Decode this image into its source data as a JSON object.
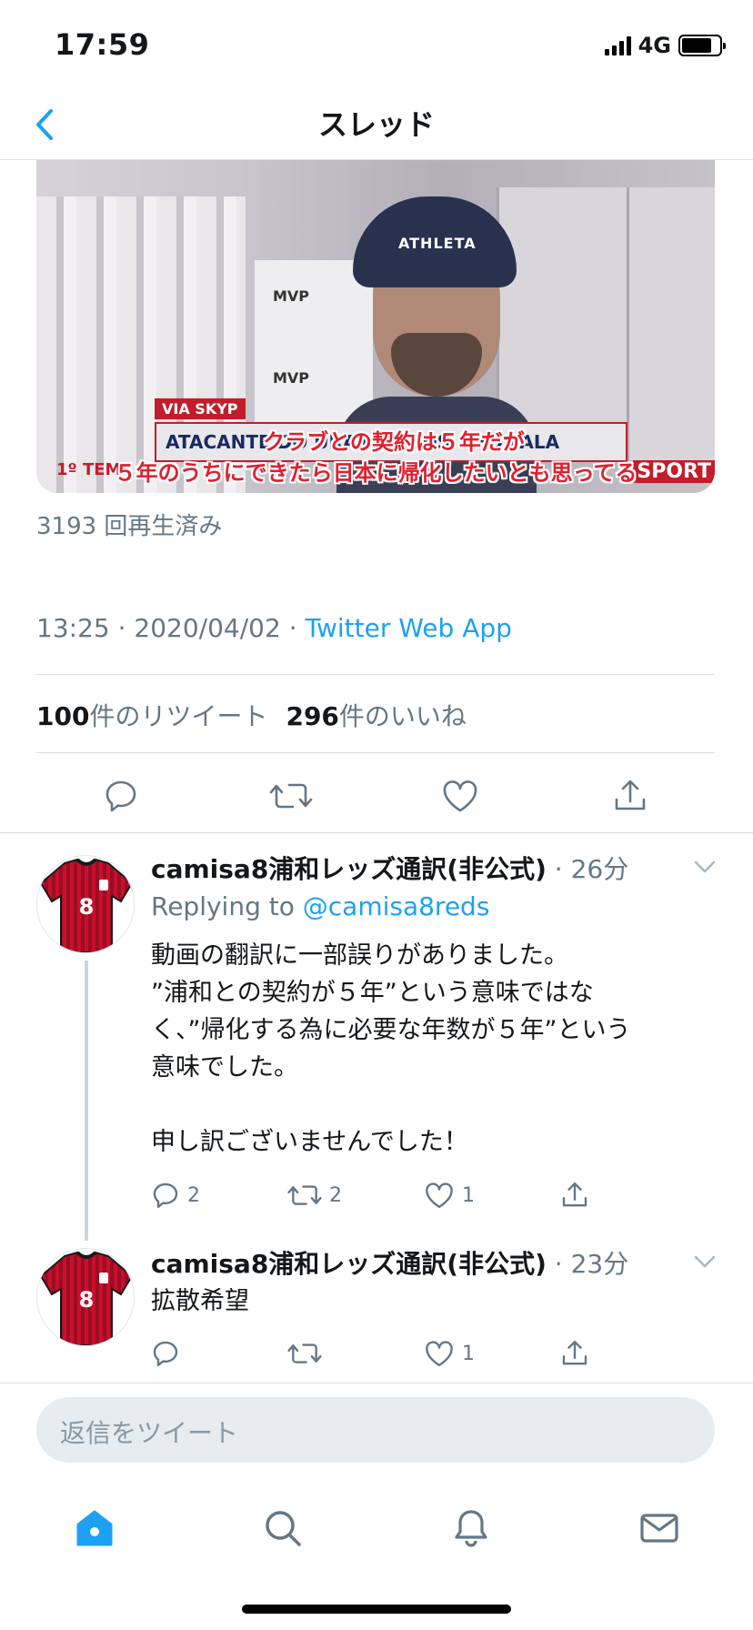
{
  "status_bar": {
    "time": "17:59",
    "network": "4G"
  },
  "nav": {
    "title": "スレッド"
  },
  "video": {
    "subtitle_line1": "クラブとの契約は５年だが",
    "subtitle_line2": "５年のうちにできたら日本に帰化したいとも思ってる",
    "via_tag": "VIA SKYP",
    "lower_third": "ATACANTE DO URAWA REDS, LEO FALA",
    "left_tag": "1º TEM",
    "right_tag": "SPORT",
    "cap_text": "ATHLETA",
    "board_text": "MVP"
  },
  "tweet": {
    "views": "3193 回再生済み",
    "time": "13:25",
    "date": "2020/04/02",
    "sep": " · ",
    "app": "Twitter Web App",
    "retweet_count": "100",
    "retweet_label": "件のリツイート",
    "like_count": "296",
    "like_label": "件のいいね"
  },
  "replies": [
    {
      "name": "camisa8浦和レッズ通訳(非公式)",
      "time": " · 26分",
      "replying_prefix": "Replying to ",
      "replying_handle": "@camisa8reds",
      "body": [
        "動画の翻訳に一部誤りがありました。",
        "”浦和との契約が５年”という意味ではな",
        "く、”帰化する為に必要な年数が５年”という",
        "意味でした。",
        "",
        "申し訳ございませんでした！"
      ],
      "reply_count": "2",
      "retweet_count": "2",
      "like_count": "1"
    },
    {
      "name": "camisa8浦和レッズ通訳(非公式)",
      "time": " · 23分",
      "body": [
        "拡散希望"
      ],
      "reply_count": "",
      "retweet_count": "",
      "like_count": "1"
    }
  ],
  "compose": {
    "placeholder": "返信をツイート"
  },
  "avatar": {
    "number": "8"
  },
  "colors": {
    "accent": "#1da1f2",
    "secondary_text": "#657786",
    "jersey_red": "#c8102e",
    "jersey_dark": "#1a1a1a"
  },
  "icons": [
    "back-chevron-icon",
    "reply-icon",
    "retweet-icon",
    "like-icon",
    "share-icon",
    "chevron-down-icon",
    "home-icon",
    "search-icon",
    "notifications-icon",
    "messages-icon"
  ]
}
